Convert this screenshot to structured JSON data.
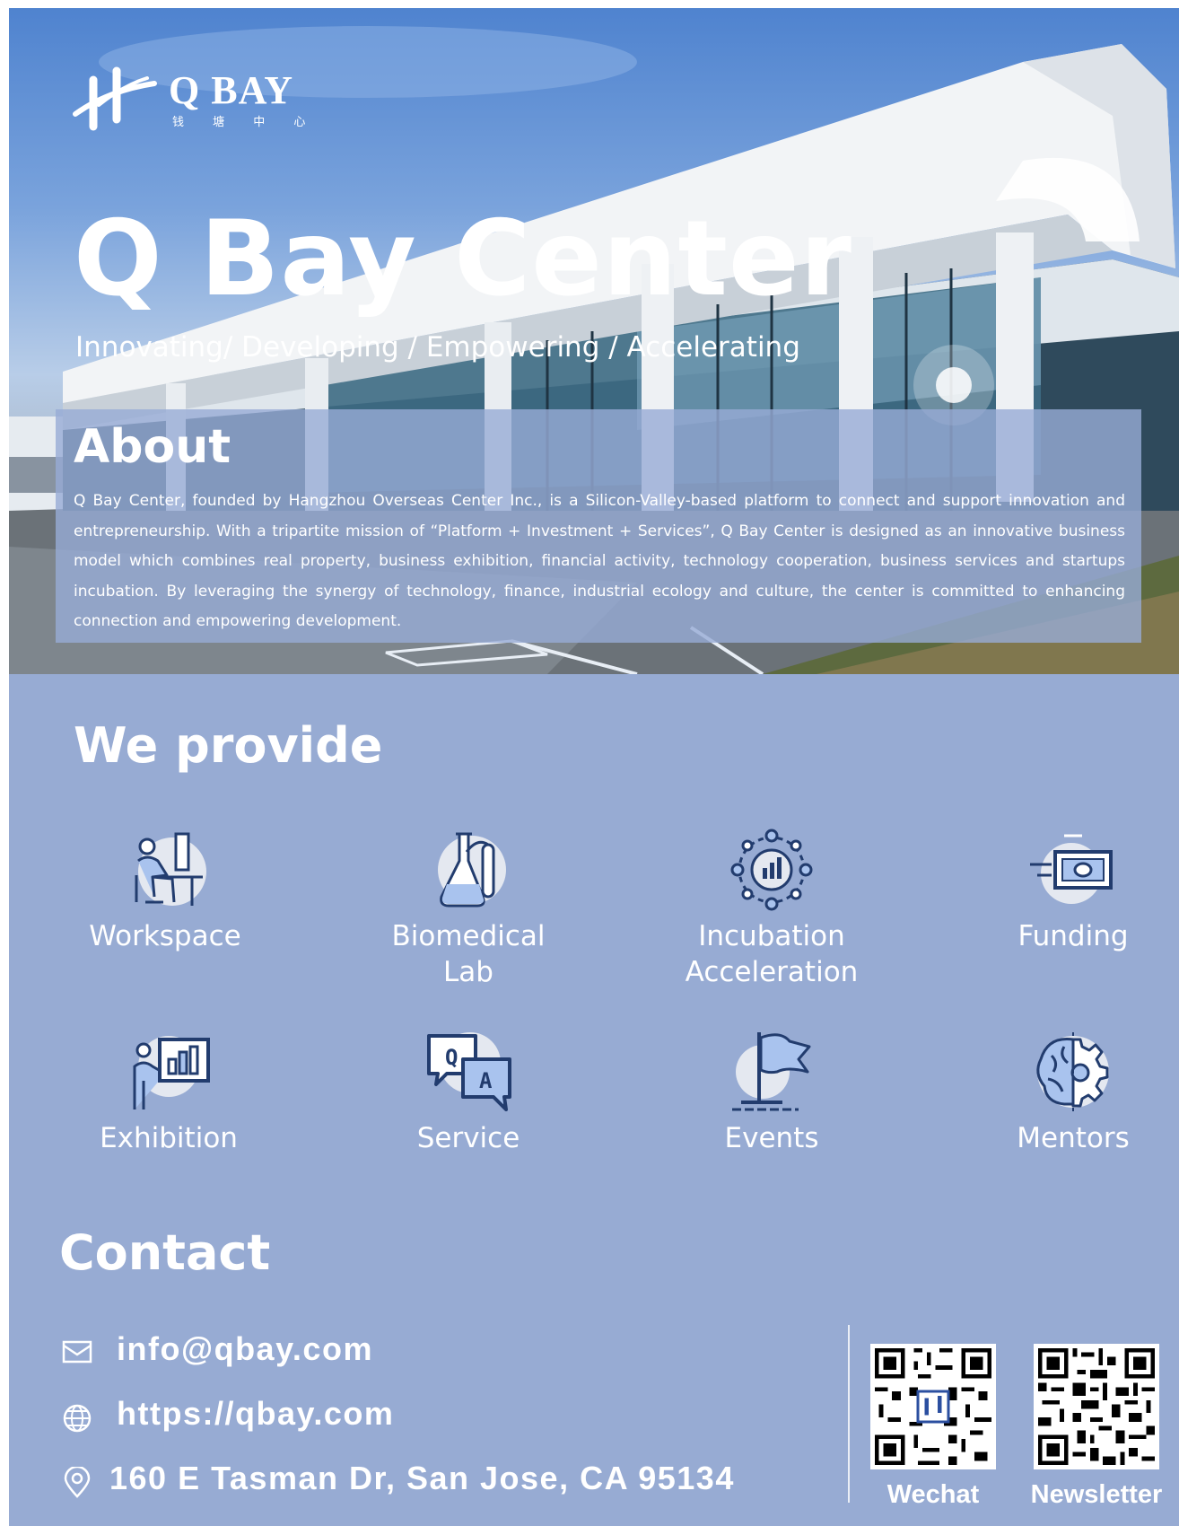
{
  "brand": {
    "logo_text": "Q BAY",
    "logo_subtext": "钱 塘 中 心"
  },
  "hero": {
    "title": "Q Bay Center",
    "tagline": "Innovating/ Developing / Empowering / Accelerating"
  },
  "about": {
    "title": "About",
    "text": "Q Bay Center, founded by Hangzhou Overseas Center Inc., is a Silicon-Valley-based platform to connect and support innovation and entrepreneurship. With a tripartite mission of “Platform + Investment + Services”, Q Bay Center is designed as an innovative business model which combines real property, business exhibition, financial activity, technology cooperation, business services and startups incubation. By leveraging the synergy of technology, finance, industrial ecology and culture, the center is committed to enhancing connection and empowering development."
  },
  "provide": {
    "title": "We provide",
    "items": [
      {
        "label": "Workspace",
        "icon": "workspace-icon"
      },
      {
        "label": "Biomedical Lab",
        "icon": "flask-icon"
      },
      {
        "label": "Incubation Acceleration",
        "icon": "incubation-icon"
      },
      {
        "label": "Funding",
        "icon": "money-icon"
      },
      {
        "label": "Exhibition",
        "icon": "presentation-icon"
      },
      {
        "label": "Service",
        "icon": "qa-chat-icon"
      },
      {
        "label": "Events",
        "icon": "flag-icon"
      },
      {
        "label": "Mentors",
        "icon": "brain-gear-icon"
      }
    ]
  },
  "contact": {
    "title": "Contact",
    "email": "info@qbay.com",
    "website": "https://qbay.com",
    "address": "160 E Tasman Dr, San Jose, CA 95134",
    "qr_wechat_label": "Wechat",
    "qr_newsletter_label": "Newsletter"
  },
  "colors": {
    "page_bg": "#97abd3",
    "icon_stroke": "#223c6e",
    "icon_fill": "#a9c3ee",
    "text": "#ffffff"
  }
}
